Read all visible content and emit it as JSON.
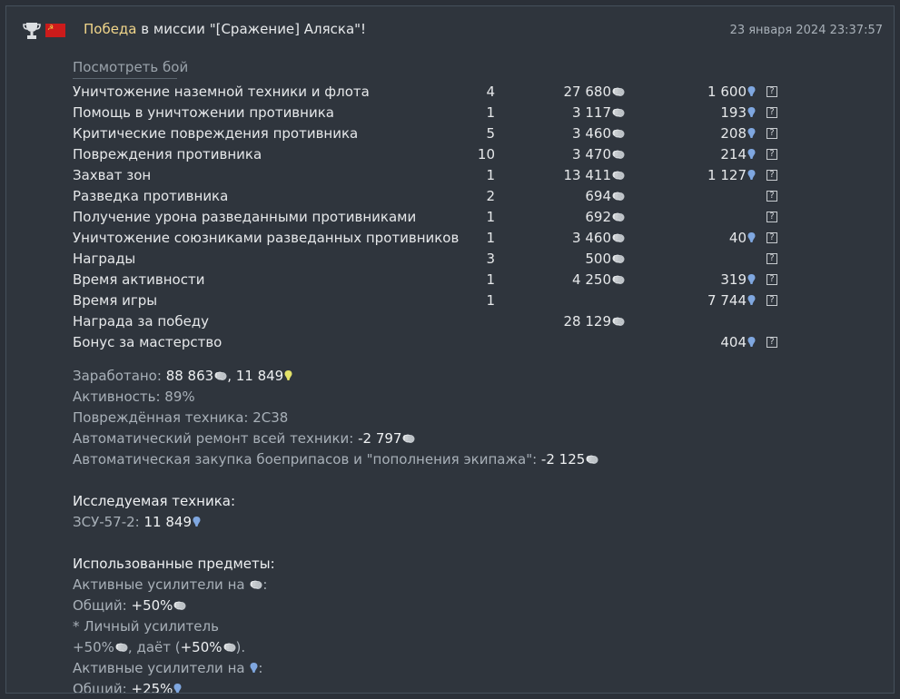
{
  "header": {
    "victory": "Победа",
    "mission_text": " в миссии \"[Сражение] Аляска\"!",
    "date": "23 января 2024 23:37:57"
  },
  "watch_battle": "Посмотреть бой",
  "rows": [
    {
      "label": "Уничтожение наземной техники и флота",
      "count": "4",
      "sl": "27 680",
      "rp": "1 600",
      "help": "?"
    },
    {
      "label": "Помощь в уничтожении противника",
      "count": "1",
      "sl": "3 117",
      "rp": "193",
      "help": "?"
    },
    {
      "label": "Критические повреждения противника",
      "count": "5",
      "sl": "3 460",
      "rp": "208",
      "help": "?"
    },
    {
      "label": "Повреждения противника",
      "count": "10",
      "sl": "3 470",
      "rp": "214",
      "help": "?"
    },
    {
      "label": "Захват зон",
      "count": "1",
      "sl": "13 411",
      "rp": "1 127",
      "help": "?"
    },
    {
      "label": "Разведка противника",
      "count": "2",
      "sl": "694",
      "rp": "",
      "help": "?"
    },
    {
      "label": "Получение урона разведанными противниками",
      "count": "1",
      "sl": "692",
      "rp": "",
      "help": "?"
    },
    {
      "label": "Уничтожение союзниками разведанных противников",
      "count": "1",
      "sl": "3 460",
      "rp": "40",
      "help": "?"
    },
    {
      "label": "Награды",
      "count": "3",
      "sl": "500",
      "rp": "",
      "help": "?"
    },
    {
      "label": "Время активности",
      "count": "1",
      "sl": "4 250",
      "rp": "319",
      "help": "?"
    },
    {
      "label": "Время игры",
      "count": "1",
      "sl": "",
      "rp": "7 744",
      "help": "?"
    },
    {
      "label": "Награда за победу",
      "count": "",
      "sl": "28 129",
      "rp": "",
      "help": ""
    },
    {
      "label": "Бонус за мастерство",
      "count": "",
      "sl": "",
      "rp": "404",
      "help": "?"
    }
  ],
  "summary": {
    "earned_label": "Заработано: ",
    "earned_sl": "88 863",
    "earned_sep": ", ",
    "earned_rp": "11 849",
    "activity_label": "Активность: 89%",
    "damaged_label": "Повреждённая техника: 2С38",
    "repair_label": "Автоматический ремонт всей техники: ",
    "repair_value": "-2 797",
    "ammo_label": "Автоматическая закупка боеприпасов и \"пополнения экипажа\": ",
    "ammo_value": "-2 125",
    "research_title": "Исследуемая техника:",
    "research_label": "ЗСУ-57-2: ",
    "research_value": "11 849",
    "items_title": "Использованные предметы:",
    "boost_sl_label": "Активные усилители на ",
    "boost_colon": ":",
    "total_label": "Общий: ",
    "total_sl": "+50%",
    "personal_label": "* Личный усилитель",
    "personal_value": "+50%",
    "gives_label": ", даёт (",
    "gives_value": "+50%",
    "gives_end": ").",
    "boost_rp_label": "Активные усилители на ",
    "total_rp": "+25%"
  },
  "colors": {
    "background": "#2f353d",
    "victory": "#f0d58a",
    "rp_icon": "#7fa7e0",
    "rp_gold": "#e3e26a",
    "silver": "#c9cdd1"
  }
}
